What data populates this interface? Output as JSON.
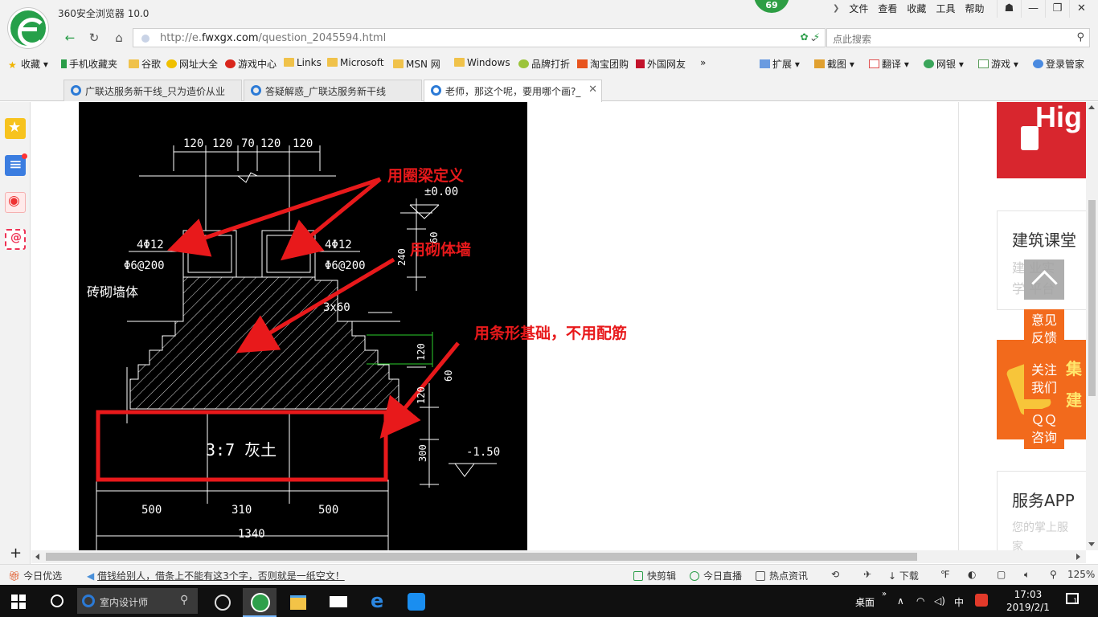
{
  "app": {
    "title": "360安全浏览器 10.0",
    "badge_count": "69",
    "menu": [
      "文件",
      "查看",
      "收藏",
      "工具",
      "帮助"
    ]
  },
  "address_bar": {
    "url_prefix": "http://e.",
    "url_domain": "fwxgx.com",
    "url_path": "/question_2045594.html",
    "search_placeholder": "点此搜索"
  },
  "bookmarks": {
    "left": [
      "收藏",
      "手机收藏夹",
      "谷歌",
      "网址大全",
      "游戏中心",
      "Links",
      "Microsoft",
      "MSN 网",
      "Windows",
      "品牌打折",
      "淘宝团购",
      "外国网友"
    ],
    "more": "»",
    "right": [
      "扩展",
      "截图",
      "翻译",
      "网银",
      "游戏",
      "登录管家"
    ]
  },
  "tabs": [
    {
      "label": "广联达服务新干线_只为造价从业",
      "active": false
    },
    {
      "label": "答疑解惑_广联达服务新干线",
      "active": false
    },
    {
      "label": "老师，那这个呢，要用哪个画?_",
      "active": true
    }
  ],
  "cad": {
    "dims_top": [
      "120",
      "120",
      "70",
      "120",
      "120"
    ],
    "elev_top": "±0.00",
    "rebar_left_1": "4Φ12",
    "rebar_left_2": "Φ6@200",
    "rebar_right_1": "4Φ12",
    "rebar_right_2": "Φ6@200",
    "wall_label": "砖砌墙体",
    "step_label": "3x60",
    "v_dims": [
      "60",
      "240",
      "120",
      "60",
      "120",
      "300"
    ],
    "elev_bottom": "-1.50",
    "fill_label": "3:7  灰土",
    "dims_bottom": [
      "500",
      "310",
      "500"
    ],
    "dim_total": "1340",
    "annotations": [
      "用圈梁定义",
      "用砌体墙",
      "用条形基础，不用配筋"
    ]
  },
  "right_panel": {
    "promo_top_text": "Hig",
    "course_title": "建筑课堂",
    "course_sub_1": "建    业实",
    "course_sub_2": "学    平台",
    "promo_mid_text": "集",
    "promo_mid_text2": "建",
    "app_title": "服务APP",
    "app_sub_1": "您的掌上服",
    "app_sub_2": "家",
    "btn_feedback": [
      "意见",
      "反馈"
    ],
    "btn_follow": [
      "关注",
      "我们"
    ],
    "btn_qq": [
      "ＱＱ",
      "咨询"
    ]
  },
  "status_bar": {
    "today_pick": "今日优选",
    "headline": "借钱给别人，借条上不能有这3个字，否则就是一纸空文！",
    "quick_clip": "快剪辑",
    "today_live": "今日直播",
    "hot_news": "热点资讯",
    "download": "下载",
    "zoom": "125%"
  },
  "taskbar": {
    "search_text": "室内设计师",
    "desktop": "桌面",
    "ime": "中",
    "time": "17:03",
    "date": "2019/2/1",
    "notifications": "1"
  }
}
